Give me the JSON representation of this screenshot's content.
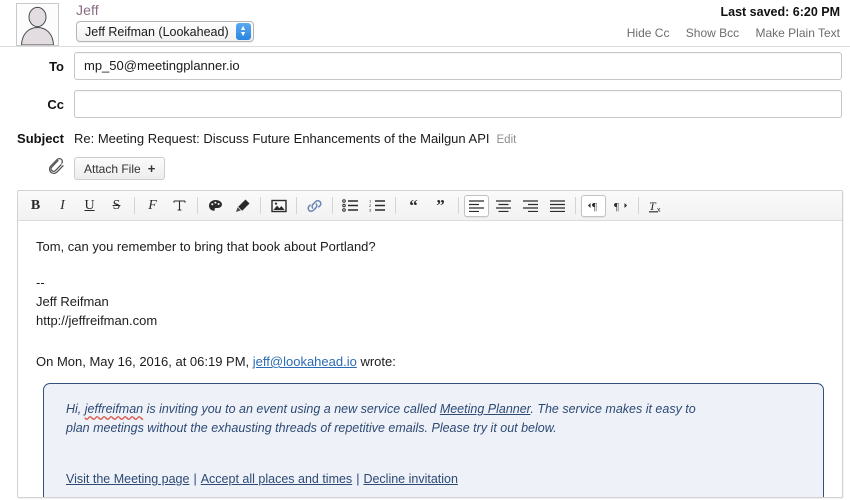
{
  "header": {
    "avatar_icon": "person-silhouette-icon",
    "display_name": "Jeff",
    "account_select": "Jeff Reifman (Lookahead)",
    "last_saved": "Last saved: 6:20 PM",
    "links": [
      "Hide Cc",
      "Show Bcc",
      "Make Plain Text"
    ]
  },
  "fields": {
    "to_label": "To",
    "to_value": "mp_50@meetingplanner.io",
    "to_placeholder": "",
    "cc_label": "Cc",
    "cc_value": "",
    "cc_placeholder": "",
    "subject_label": "Subject",
    "subject_value": "Re: Meeting Request: Discuss Future Enhancements of the Mailgun API",
    "subject_edit": "Edit"
  },
  "attach": {
    "clip_icon": "paperclip-icon",
    "button_label": "Attach File",
    "button_plus": "+"
  },
  "toolbar": {
    "items": [
      {
        "name": "bold-icon",
        "glyph": "B",
        "active": false
      },
      {
        "name": "italic-icon",
        "glyph": "I",
        "active": false
      },
      {
        "name": "underline-icon",
        "glyph": "U",
        "active": false
      },
      {
        "name": "strikethrough-icon",
        "glyph": "S",
        "active": false
      },
      {
        "name": "font-family-icon",
        "glyph": "F",
        "active": false
      },
      {
        "name": "font-size-icon",
        "glyph": "T",
        "active": false
      },
      {
        "name": "text-color-palette-icon",
        "glyph": "palette",
        "active": false
      },
      {
        "name": "highlighter-icon",
        "glyph": "pen",
        "active": false
      },
      {
        "name": "insert-image-icon",
        "glyph": "image",
        "active": false
      },
      {
        "name": "insert-link-icon",
        "glyph": "link",
        "active": false
      },
      {
        "name": "bulleted-list-icon",
        "glyph": "ul",
        "active": false
      },
      {
        "name": "numbered-list-icon",
        "glyph": "ol",
        "active": false
      },
      {
        "name": "blockquote-open-icon",
        "glyph": "66",
        "active": false
      },
      {
        "name": "blockquote-close-icon",
        "glyph": "99",
        "active": false
      },
      {
        "name": "align-left-icon",
        "glyph": "align-left",
        "active": true
      },
      {
        "name": "align-center-icon",
        "glyph": "align-center",
        "active": false
      },
      {
        "name": "align-right-icon",
        "glyph": "align-right",
        "active": false
      },
      {
        "name": "align-justify-icon",
        "glyph": "align-justify",
        "active": false
      },
      {
        "name": "direction-ltr-icon",
        "glyph": "pilcrow-ltr",
        "active": true
      },
      {
        "name": "direction-rtl-icon",
        "glyph": "pilcrow-rtl",
        "active": false
      },
      {
        "name": "clear-formatting-icon",
        "glyph": "Ix",
        "active": false
      }
    ]
  },
  "body": {
    "greeting": "Tom, can you remember to bring that book about Portland?",
    "sig_dashes": "--",
    "sig_name": "Jeff Reifman",
    "sig_url": "http://jeffreifman.com",
    "quote_head_before": "On Mon, May 16, 2016, at 06:19 PM, ",
    "quote_head_link": "jeff@lookahead.io",
    "quote_head_after": " wrote:"
  },
  "quote": {
    "line1_a": "Hi, ",
    "line1_misspelled": "jeffreifman",
    "line1_b": " is inviting you to an event using a new service called ",
    "line1_link": "Meeting Planner",
    "line1_c": ". The service makes it easy to",
    "line2": "plan meetings without the exhausting threads of repetitive emails. Please try it out below.",
    "links": [
      "Visit the Meeting page",
      "Accept all places and times",
      "Decline invitation"
    ],
    "separator": "|"
  },
  "colors": {
    "name_purple": "#8a6d84",
    "link_blue": "#2b6bb5",
    "quote_border": "#32517f",
    "quote_bg": "#eef1f8",
    "quote_text": "#2d4a74",
    "stepper_blue": "#2b86e0",
    "spellcheck_red": "#d94f43"
  }
}
